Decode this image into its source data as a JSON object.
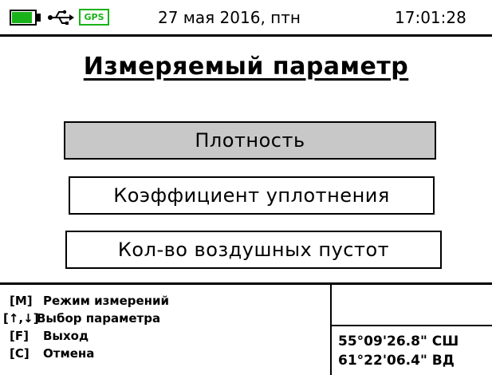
{
  "status": {
    "battery_level": 0.88,
    "battery_color": "#19b319",
    "usb_icon": "usb-icon",
    "gps_label": "GPS",
    "date": "27 мая 2016, птн",
    "time": "17:01:28"
  },
  "title": "Измеряемый параметр",
  "options": [
    {
      "label": "Плотность",
      "selected": true
    },
    {
      "label": "Коэффициент уплотнения",
      "selected": false
    },
    {
      "label": "Кол-во воздушных пустот",
      "selected": false
    }
  ],
  "hints": [
    {
      "key": "[M]",
      "desc": "Режим измерений"
    },
    {
      "key": "[↑,↓]",
      "desc": "Выбор параметра"
    },
    {
      "key": "[F]",
      "desc": "Выход"
    },
    {
      "key": "[C]",
      "desc": "Отмена"
    }
  ],
  "coords": {
    "lat": "55°09'26.8\" СШ",
    "lon": "61°22'06.4\" ВД"
  },
  "colors": {
    "selected_bg": "#c8c8c8",
    "accent": "#19b319"
  }
}
